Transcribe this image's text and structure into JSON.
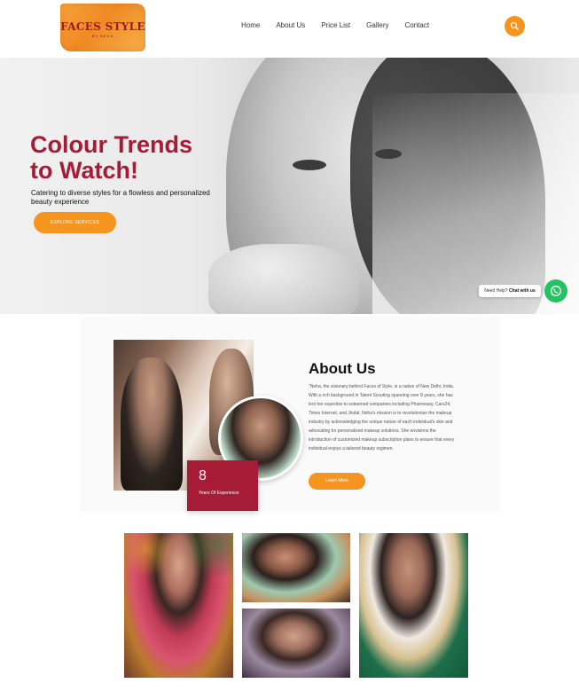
{
  "header": {
    "logo_text": "FACES STYLE",
    "logo_sub": "BY NEHA",
    "nav": [
      "Home",
      "About Us",
      "Price List",
      "Gallery",
      "Contact"
    ],
    "search_icon": "search-icon"
  },
  "hero": {
    "title_line1": "Colour Trends",
    "title_line2": "to Watch!",
    "subtitle": "Catering to diverse styles for a flowless and personalized beauty experience",
    "button": "EXPLORE SERVICES"
  },
  "whatsapp": {
    "label_prefix": "Need Help?",
    "label_bold": "Chat with us",
    "icon": "whatsapp-icon"
  },
  "about": {
    "title": "About Us",
    "body": "\"Neha, the visionary behind Faces of Style, is a native of New Delhi, India. With a rich background in Talent Scouting spanning over 8 years, she has lent her expertise to esteemed companies including Pharmeasy, Cars24, Times Internet, and Jindal. Neha's mission is to revolutionize the makeup industry by acknowledging the unique nature of each individual's skin and advocating for personalized makeup solutions. She envisions the introduction of customized makeup subscription plans to ensure that every individual enjoys a tailored beauty regimen.",
    "button": "Learn More",
    "experience_number": "8",
    "experience_label": "Years Of Experience"
  },
  "colors": {
    "accent": "#f5951f",
    "brand": "#a61b36",
    "whatsapp": "#25c263"
  }
}
